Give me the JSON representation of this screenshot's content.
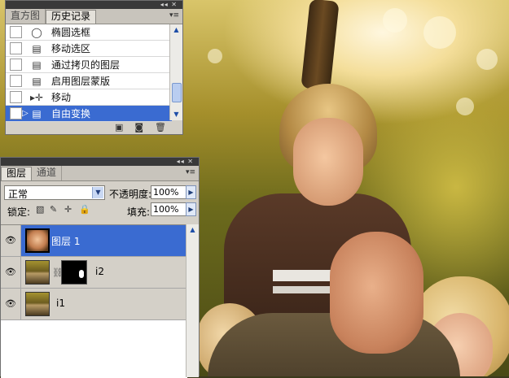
{
  "history_panel": {
    "tabs": [
      {
        "label": "直方图",
        "active": false
      },
      {
        "label": "历史记录",
        "active": true
      }
    ],
    "items": [
      {
        "label": "椭圆选框",
        "icon": "ellipse-marquee-icon",
        "selected": false
      },
      {
        "label": "移动选区",
        "icon": "document-icon",
        "selected": false
      },
      {
        "label": "通过拷贝的图层",
        "icon": "document-icon",
        "selected": false
      },
      {
        "label": "启用图层蒙版",
        "icon": "document-icon",
        "selected": false
      },
      {
        "label": "移动",
        "icon": "move-icon",
        "selected": false
      },
      {
        "label": "自由变换",
        "icon": "document-icon",
        "selected": true
      }
    ]
  },
  "layers_panel": {
    "tabs": [
      {
        "label": "图层",
        "active": true
      },
      {
        "label": "通道",
        "active": false
      }
    ],
    "blend_mode": "正常",
    "opacity_label": "不透明度:",
    "opacity_value": "100%",
    "lock_label": "锁定:",
    "fill_label": "填充:",
    "fill_value": "100%",
    "layers": [
      {
        "name": "图层 1",
        "selected": true,
        "visible": true,
        "has_mask": false
      },
      {
        "name": "i2",
        "selected": false,
        "visible": true,
        "has_mask": true
      },
      {
        "name": "i1",
        "selected": false,
        "visible": true,
        "has_mask": false
      }
    ]
  },
  "colors": {
    "selection": "#3a6bd1",
    "panel": "#d4d0c8",
    "titlebar": "#393939"
  }
}
